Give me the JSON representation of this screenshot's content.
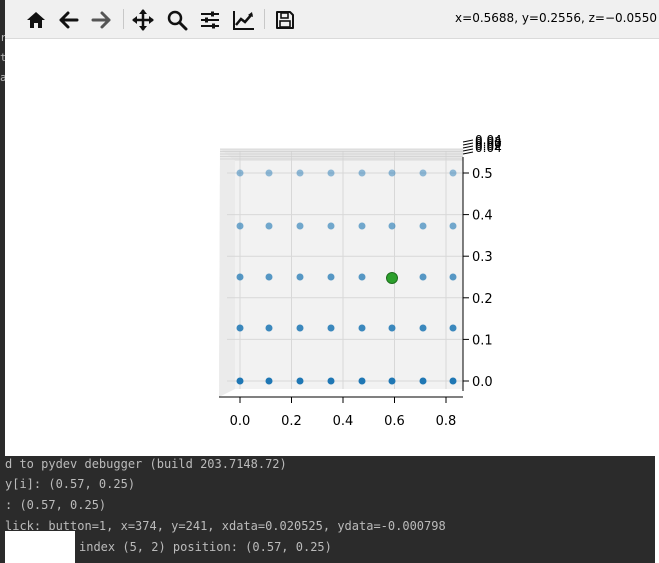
{
  "toolbar": {
    "buttons": [
      {
        "name": "home-icon"
      },
      {
        "name": "back-arrow-icon"
      },
      {
        "name": "forward-arrow-icon"
      },
      {
        "name": "pan-icon"
      },
      {
        "name": "zoom-icon"
      },
      {
        "name": "configure-subplots-icon"
      },
      {
        "name": "edit-axis-icon"
      },
      {
        "name": "save-icon"
      }
    ],
    "coords_text": "x=0.5688, y=0.2556, z=−0.0550"
  },
  "left_strip": {
    "fragments": [
      "r",
      "t",
      "a"
    ]
  },
  "chart_data": {
    "type": "scatter",
    "x": [
      0.0,
      0.1,
      0.2,
      0.3,
      0.4,
      0.5,
      0.6,
      0.7
    ],
    "y": [
      0.0,
      0.125,
      0.25,
      0.375,
      0.5
    ],
    "highlighted_point": {
      "x": 0.57,
      "y": 0.25,
      "color": "#2ca02c"
    },
    "xticks": [
      "0.0",
      "0.2",
      "0.4",
      "0.6",
      "0.8"
    ],
    "yticks": [
      "0.0",
      "0.1",
      "0.2",
      "0.3",
      "0.4",
      "0.5"
    ],
    "zticks": [
      "0.04",
      "0.02",
      "0.00",
      "−0.02",
      "−0.04"
    ],
    "zticks_visible": [
      "0.04",
      "0.02",
      "0.00",
      "0.02",
      "0.04"
    ],
    "xlim": [
      0.0,
      0.8
    ],
    "ylim": [
      0.0,
      0.5
    ],
    "grid": true,
    "point_color": "#1f77b4",
    "colors": {
      "pane": "#f2f2f2",
      "grid": "#d8d8d8",
      "axis": "#000000"
    }
  },
  "console": {
    "lines": [
      "d to pydev debugger (build 203.7148.72)",
      "y[i]: (0.57, 0.25)",
      ": (0.57, 0.25)",
      "lick: button=1, x=374, y=241, xdata=0.020525, ydata=-0.000798",
      "index (5, 2) position: (0.57, 0.25)"
    ]
  }
}
